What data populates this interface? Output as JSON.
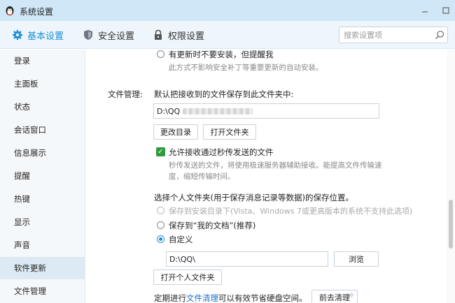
{
  "window": {
    "title": "系统设置"
  },
  "tabs": [
    {
      "label": "基本设置",
      "icon": "gear-icon",
      "active": true
    },
    {
      "label": "安全设置",
      "icon": "shield-icon"
    },
    {
      "label": "权限设置",
      "icon": "lock-icon"
    }
  ],
  "search": {
    "placeholder": "搜索设置项"
  },
  "sidebar": {
    "items": [
      {
        "label": "登录"
      },
      {
        "label": "主面板"
      },
      {
        "label": "状态"
      },
      {
        "label": "会话窗口"
      },
      {
        "label": "信息展示"
      },
      {
        "label": "提醒"
      },
      {
        "label": "热键"
      },
      {
        "label": "显示"
      },
      {
        "label": "声音"
      },
      {
        "label": "软件更新",
        "active": true
      },
      {
        "label": "文件管理"
      }
    ]
  },
  "update": {
    "option_label": "有更新时不要安装，但提醒我",
    "option_desc": "此方式不影响安全补丁等重要更新的自动安装。"
  },
  "file_management": {
    "section_label": "文件管理:",
    "save_desc": "默认把接收到的文件保存到此文件夹中:",
    "save_path": "D:\\QQ",
    "change_dir_button": "更改目录",
    "open_folder_button": "打开文件夹",
    "flash_transfer_label": "允许接收通过秒传发送的文件",
    "flash_transfer_desc_1": "秒传发送的文件，将使用极速服务器辅助接收。能提高文件传输速",
    "flash_transfer_desc_2": "度，缩短传输时间。",
    "personal_folder_desc": "选择个人文件夹(用于保存消息记录等数据)的保存位置。",
    "opt_install_dir": "保存到安装目录下(Vista、Windows 7或更高版本的系统不支持此选项)",
    "opt_my_docs": "保存到“我的文档”(推荐)",
    "opt_custom": "自定义",
    "custom_path": "D:\\QQ\\",
    "browse_button": "浏览",
    "open_personal_button": "打开个人文件夹",
    "cleanup_prefix": "定期进行",
    "cleanup_link": "文件清理",
    "cleanup_suffix": "可以有效节省硬盘空间。",
    "cleanup_button": "前去清理"
  },
  "colors": {
    "accent": "#1c8ed8",
    "checkbox": "#2e9b3e",
    "titlebar": "#cfe7f7"
  }
}
